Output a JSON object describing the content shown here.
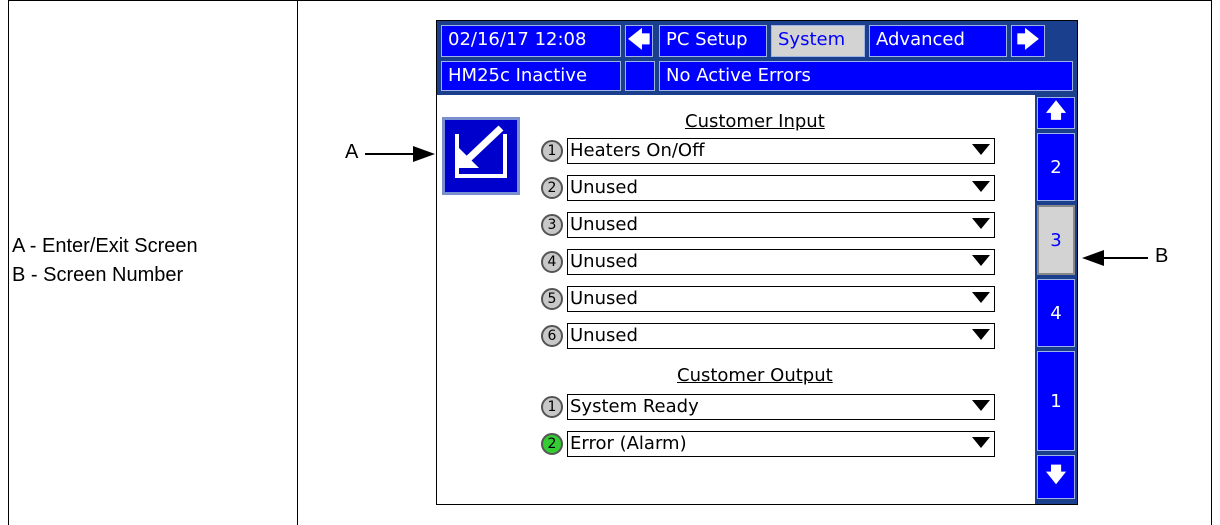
{
  "legend": {
    "a": "A - Enter/Exit Screen",
    "b": "B - Screen Number"
  },
  "callouts": {
    "a": "A",
    "b": "B"
  },
  "header": {
    "datetime": "02/16/17 12:08",
    "tabs": [
      {
        "label": "PC Setup",
        "selected": false
      },
      {
        "label": "System",
        "selected": true
      },
      {
        "label": "Advanced",
        "selected": false
      }
    ],
    "status": "HM25c Inactive",
    "errors": "No Active Errors"
  },
  "customer_input": {
    "title": "Customer Input",
    "rows": [
      {
        "num": "1",
        "value": "Heaters On/Off"
      },
      {
        "num": "2",
        "value": "Unused"
      },
      {
        "num": "3",
        "value": "Unused"
      },
      {
        "num": "4",
        "value": "Unused"
      },
      {
        "num": "5",
        "value": "Unused"
      },
      {
        "num": "6",
        "value": "Unused"
      }
    ]
  },
  "customer_output": {
    "title": "Customer Output",
    "rows": [
      {
        "num": "1",
        "value": "System Ready",
        "active": false
      },
      {
        "num": "2",
        "value": "Error (Alarm)",
        "active": true
      }
    ]
  },
  "screens": {
    "items": [
      "2",
      "3",
      "4",
      "1"
    ],
    "selected": "3"
  },
  "colors": {
    "button_blue": "#0000ff",
    "header_navy": "#1a3f8c",
    "selected_gray": "#d3d3d3",
    "active_indicator": "#33cc33"
  }
}
